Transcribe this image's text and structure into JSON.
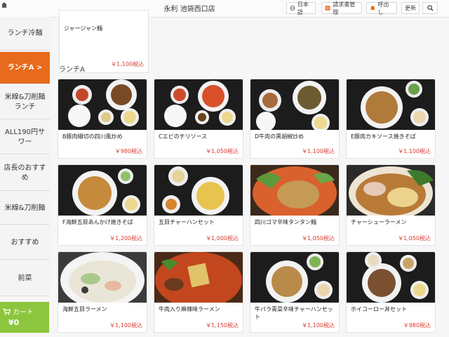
{
  "header": {
    "store_name": "永利 池袋西口店",
    "language": "日本語",
    "bill": "請求書管理",
    "call": "呼出し",
    "refresh": "更新"
  },
  "sidebar": {
    "items": [
      {
        "label": "ランチ冷麺"
      },
      {
        "label": "ランチA >"
      },
      {
        "label": "米線&刀削麺ランチ"
      },
      {
        "label": "ALL190円サワー"
      },
      {
        "label": "店長のおすすめ"
      },
      {
        "label": "米線&刀削麺"
      },
      {
        "label": "おすすめ"
      },
      {
        "label": "前菜"
      }
    ],
    "cart_label": "カート",
    "cart_total": "¥0"
  },
  "partial_item": {
    "name": "ジャージャン麺",
    "price": "￥1,100税込"
  },
  "section_title": "ランチA",
  "items": [
    {
      "name": "B豚肉細切の四川風炒め",
      "price": "￥980税込"
    },
    {
      "name": "Cエビのチリソース",
      "price": "￥1,050税込"
    },
    {
      "name": "D牛肉の黒胡椒炒め",
      "price": "￥1,100税込"
    },
    {
      "name": "E豚肉カキソース焼きそば",
      "price": "￥1,100税込"
    },
    {
      "name": "F海鮮五目あんかけ焼きそば",
      "price": "￥1,200税込"
    },
    {
      "name": "五目チャーハンセット",
      "price": "￥1,000税込"
    },
    {
      "name": "四川ゴマ辛味タンタン麺",
      "price": "￥1,050税込"
    },
    {
      "name": "チャーシューラーメン",
      "price": "￥1,050税込"
    },
    {
      "name": "海鮮五目ラーメン",
      "price": "￥1,100税込"
    },
    {
      "name": "牛肉入り麻辣味ラーメン",
      "price": "￥1,150税込"
    },
    {
      "name": "牛バラ青菜辛味チャーハンセット",
      "price": "￥1,100税込"
    },
    {
      "name": "ホイコーロー丼セット",
      "price": "￥980税込"
    }
  ],
  "colors": {
    "accent": "#e86a1c",
    "price": "#d9382c",
    "cart": "#8bc63e"
  },
  "icons": [
    "home-icon",
    "globe-icon",
    "bill-icon",
    "bell-icon",
    "search-icon",
    "cart-icon"
  ]
}
